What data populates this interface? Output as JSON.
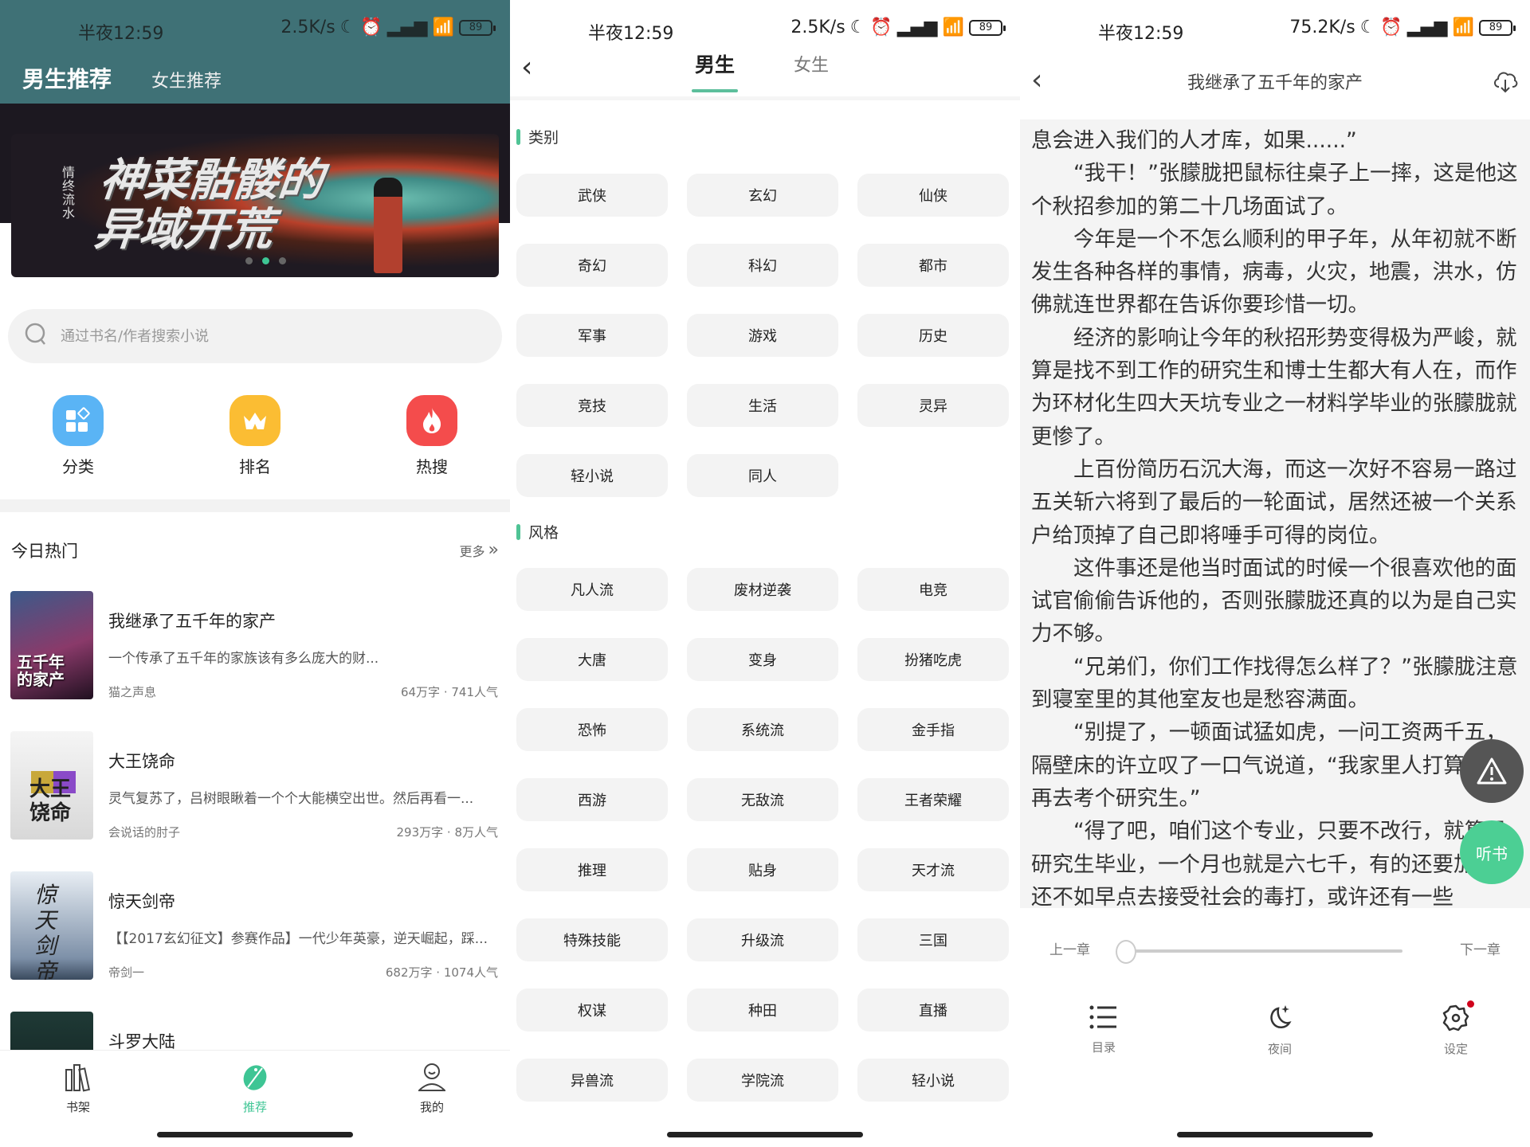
{
  "status_bars": [
    {
      "time": "半夜12:59",
      "speed": "2.5K/s",
      "battery": "89"
    },
    {
      "time": "半夜12:59",
      "speed": "2.5K/s",
      "battery": "89"
    },
    {
      "time": "半夜12:59",
      "speed": "75.2K/s",
      "battery": "89"
    }
  ],
  "home": {
    "tabs": [
      {
        "label": "男生推荐",
        "active": true
      },
      {
        "label": "女生推荐",
        "active": false
      }
    ],
    "banner": {
      "title_line1": "神菜骷髅的",
      "title_line2": "异域开荒",
      "author": "情终流水",
      "slides": 3,
      "active_slide": 2
    },
    "search": {
      "placeholder": "通过书名/作者搜索小说",
      "value": ""
    },
    "quick_links": [
      {
        "label": "分类",
        "icon": "grid-icon",
        "color": "#5ab4f5"
      },
      {
        "label": "排名",
        "icon": "crown-icon",
        "color": "#fbbd33"
      },
      {
        "label": "热搜",
        "icon": "flame-icon",
        "color": "#f44c4c"
      }
    ],
    "section": {
      "title": "今日热门",
      "more": "更多"
    },
    "books": [
      {
        "title": "我继承了五千年的家产",
        "desc": "一个传承了五千年的家族该有多么庞大的财...",
        "author": "猫之声息",
        "stats": "64万字 · 741人气"
      },
      {
        "title": "大王饶命",
        "desc": "灵气复苏了，吕树眼瞅着一个个大能横空出世。然后再看一...",
        "author": "会说话的肘子",
        "stats": "293万字 · 8万人气"
      },
      {
        "title": "惊天剑帝",
        "desc": "【【2017玄幻征文】参赛作品】一代少年英豪，逆天崛起，踩...",
        "author": "帝剑一",
        "stats": "682万字 · 1074人气"
      },
      {
        "title": "斗罗大陆",
        "desc": "",
        "author": "",
        "stats": ""
      }
    ],
    "tabbar": [
      {
        "label": "书架",
        "icon": "bookshelf-icon",
        "active": false
      },
      {
        "label": "推荐",
        "icon": "recommend-icon",
        "active": true
      },
      {
        "label": "我的",
        "icon": "profile-icon",
        "active": false
      }
    ],
    "accent": "#3ec594",
    "header_color": "#3f7176"
  },
  "category": {
    "tabs": [
      {
        "label": "男生",
        "active": true
      },
      {
        "label": "女生",
        "active": false
      }
    ],
    "groups": [
      {
        "label": "类别",
        "tags": [
          "武侠",
          "玄幻",
          "仙侠",
          "奇幻",
          "科幻",
          "都市",
          "军事",
          "游戏",
          "历史",
          "竞技",
          "生活",
          "灵异",
          "轻小说",
          "同人"
        ]
      },
      {
        "label": "风格",
        "tags": [
          "凡人流",
          "废材逆袭",
          "电竞",
          "大唐",
          "变身",
          "扮猪吃虎",
          "恐怖",
          "系统流",
          "金手指",
          "西游",
          "无敌流",
          "王者荣耀",
          "推理",
          "贴身",
          "天才流",
          "特殊技能",
          "升级流",
          "三国",
          "权谋",
          "种田",
          "直播",
          "异兽流",
          "学院流",
          "轻小说"
        ]
      }
    ]
  },
  "reader": {
    "title": "我继承了五千年的家产",
    "paragraphs": [
      {
        "text": "息会进入我们的人才库，如果......”",
        "continued": true
      },
      {
        "text": "“我干！”张朦胧把鼠标往桌子上一摔，这是他这个秋招参加的第二十几场面试了。",
        "continued": false
      },
      {
        "text": "今年是一个不怎么顺利的甲子年，从年初就不断发生各种各样的事情，病毒，火灾，地震，洪水，仿佛就连世界都在告诉你要珍惜一切。",
        "continued": false
      },
      {
        "text": "经济的影响让今年的秋招形势变得极为严峻，就算是找不到工作的研究生和博士生都大有人在，而作为环材化生四大天坑专业之一材料学毕业的张朦胧就更惨了。",
        "continued": false
      },
      {
        "text": "上百份简历石沉大海，而这一次好不容易一路过五关斩六将到了最后的一轮面试，居然还被一个关系户给顶掉了自己即将唾手可得的岗位。",
        "continued": false
      },
      {
        "text": "这件事还是他当时面试的时候一个很喜欢他的面试官偷偷告诉他的，否则张朦胧还真的以为是自己实力不够。",
        "continued": false
      },
      {
        "text": "“兄弟们，你们工作找得怎么样了？”张朦胧注意到寝室里的其他室友也是愁容满面。",
        "continued": false
      },
      {
        "text": "“别提了，一顿面试猛如虎，一问工资两千五，隔壁床的许立叹了一口气说道，“我家里人打算让我再去考个研究生。”",
        "continued": false
      },
      {
        "text": "“得了吧，咱们这个专业，只要不改行，就算是研究生毕业，一个月也就是六七千，有的还要加班，还不如早点去接受社会的毒打，或许还有一些",
        "continued": false
      }
    ],
    "listen_label": "听书",
    "prev_chapter": "上一章",
    "next_chapter": "下一章",
    "chapter_progress": 0,
    "tools": [
      {
        "label": "目录",
        "icon": "list-icon"
      },
      {
        "label": "夜间",
        "icon": "night-mode-icon"
      },
      {
        "label": "设定",
        "icon": "settings-icon",
        "badge": true
      }
    ]
  }
}
